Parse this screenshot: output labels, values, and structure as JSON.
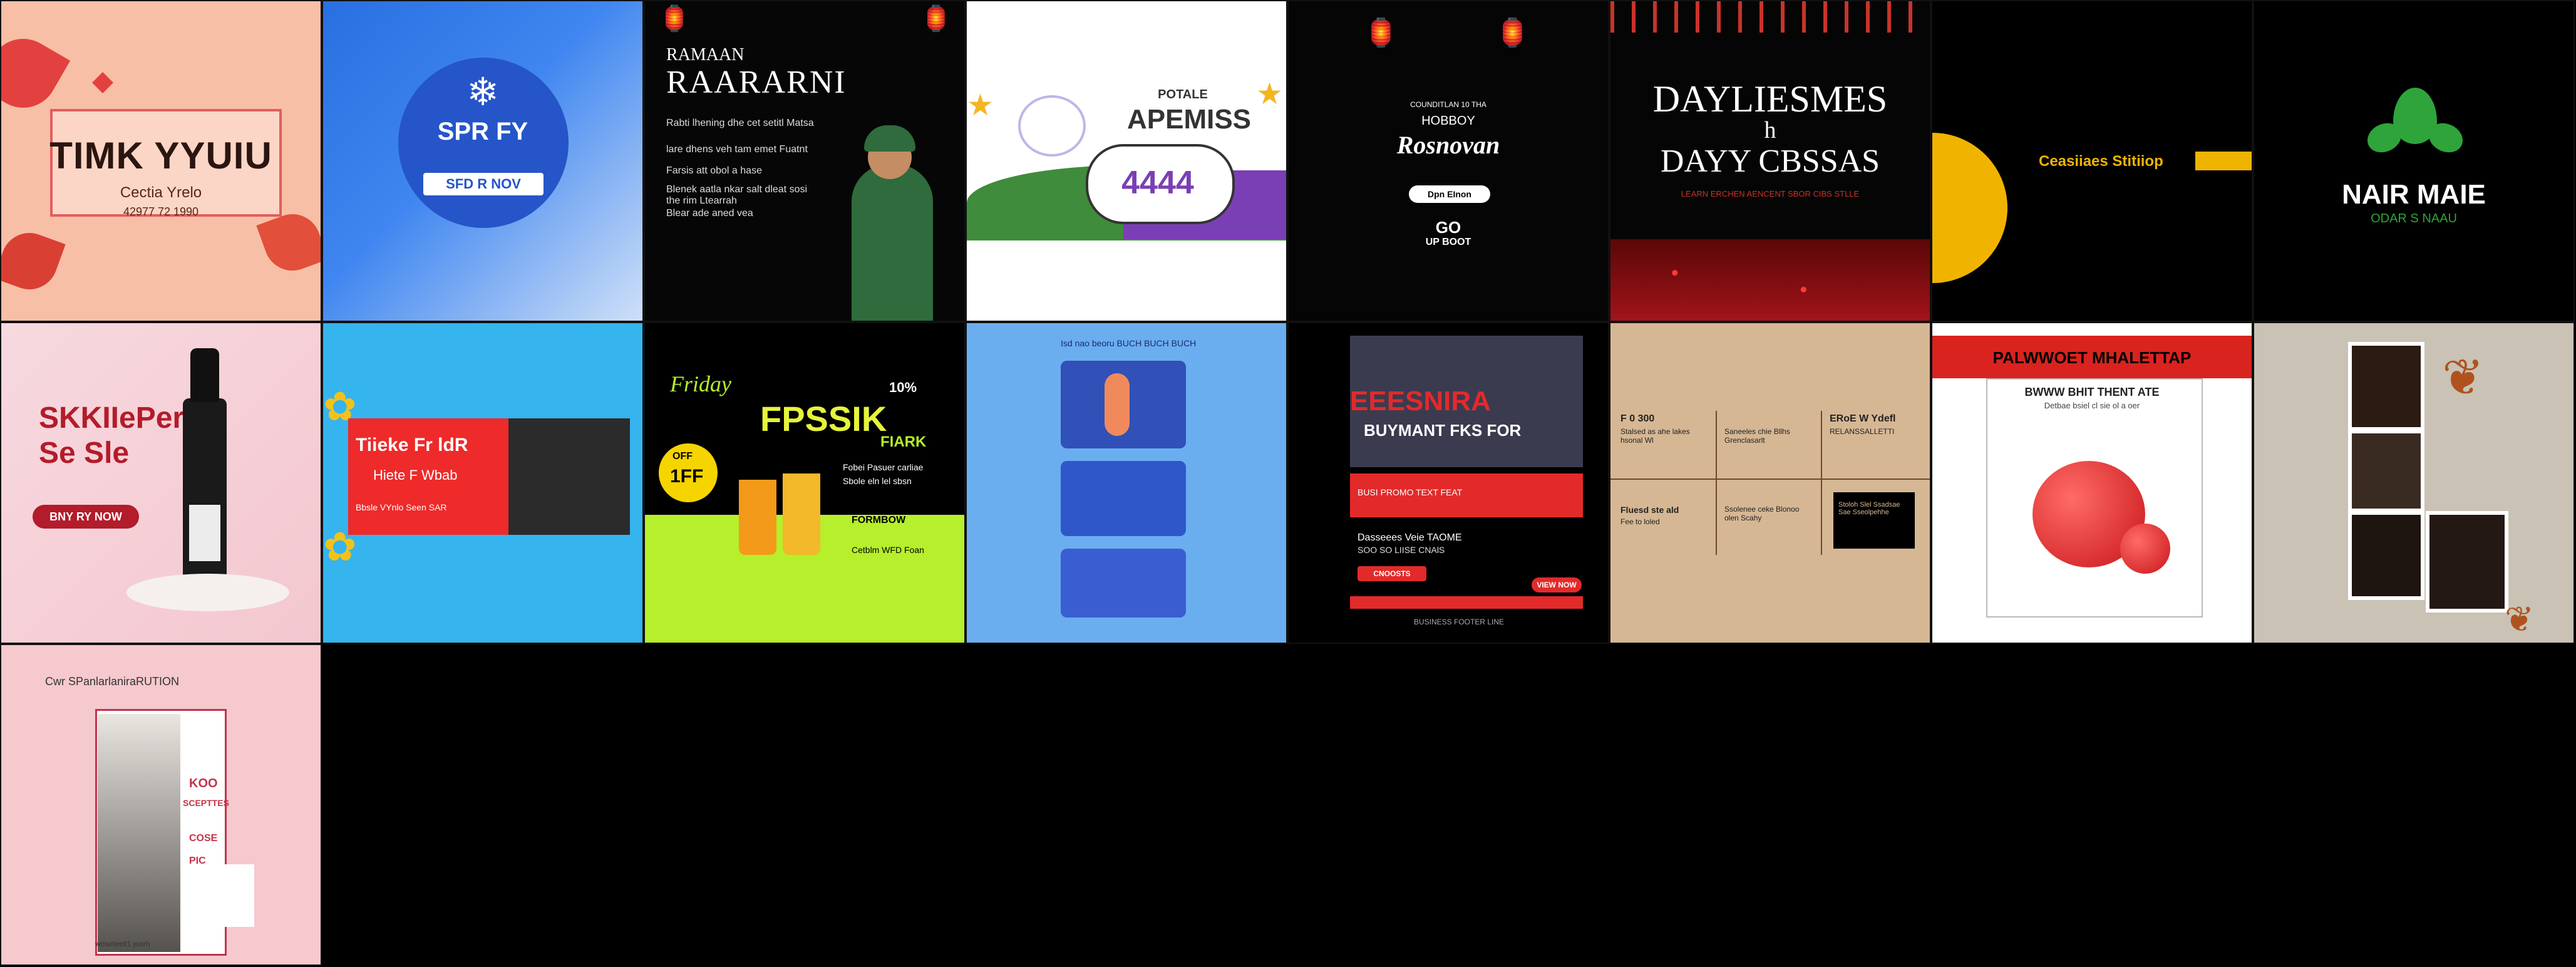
{
  "tiles": {
    "thank_you": {
      "title": "TIMK YYUIU",
      "subtitle": "Cectia Yrelo",
      "line": "42977 72 1990"
    },
    "spring": {
      "title": "SPR FY",
      "button": "SFD R NOV"
    },
    "ramadan": {
      "small": "RAMAAN",
      "title": "RAARARNI",
      "para1": "Rabti lhening dhe cet setitl Matsa",
      "para2": "lare dhens veh tam emet Fuatnt",
      "para3": "Farsis att obol a hase",
      "para4": "Blenek aatla nkar salt dleat sosi the rim Ltearrah",
      "para5": "Blear ade aned vea"
    },
    "unicorn": {
      "small": "POTALE",
      "title": "APEMISS",
      "numbers": "4444"
    },
    "hobby_ramadan": {
      "small": "COUNDITLAN 10 THA",
      "line1": "HOBBOY",
      "script": "Rosnovan",
      "button": "Dpn EInon",
      "num": "GO",
      "line3": "UP BOOT"
    },
    "daylights": {
      "line1": "DAYLIESMES",
      "line2": "h",
      "line3": "DAYY CBSSAS",
      "tagline": "LEARN ERCHEN AENCENT SBOR CIBS STLLE"
    },
    "studio": {
      "text": "Ceasiiaes Stitiiop"
    },
    "hair": {
      "title": "NAIR MAIE",
      "subtitle": "ODAR S NAAU"
    },
    "skincare": {
      "title1": "SKKIIePer",
      "title2": "Se Sle",
      "button": "BNY RY NOW"
    },
    "thanks_web": {
      "title": "Tiieke Fr ldR",
      "subtitle": "Hiete F Wbab",
      "line": "Bbsle VYnlo Seen SAR"
    },
    "juice": {
      "script": "Friday",
      "badge_top": "10%",
      "title": "FPSSIK",
      "sub": "FIARK",
      "pct": "OFF",
      "badge_num": "1FF",
      "text1": "Fobei Pasuer carliae",
      "text2": "Sbole eln lel sbsn",
      "text3": "FORMBOW",
      "text4": "Cetblm WFD Foan"
    },
    "illustration": {
      "header": "Isd nao beoru BUCH BUCH BUCH"
    },
    "business": {
      "title": "EEESNIRA",
      "subtitle": "BUYMANT FKS FOR",
      "line1": "BUSI PROMO TEXT FEAT",
      "line2": "Dasseees Veie TAOME",
      "line3": "SOO SO LIISE CNAlS",
      "button": "VIEW NOW",
      "btn2": "CNOOSTS",
      "foot": "BUSINESS FOOTER LINE"
    },
    "menu": {
      "cells": [
        {
          "title": "F 0 300",
          "body": "Stalsed as ahe lakes hsonal Wl"
        },
        {
          "title": "",
          "body": "Saneeles chie Bllhs Grenclasarlt"
        },
        {
          "title": "ERoE W Ydefl",
          "body": "RELANSSALLETTI"
        },
        {
          "title": "Fluesd ste ald",
          "body": "Fee to loled"
        },
        {
          "title": "",
          "body": "Ssolenee ceke Blonoo olen Scahy"
        },
        {
          "title": "",
          "body": "Stoloh Slel Ssadsae Sae Sseolpehhe"
        }
      ]
    },
    "product": {
      "banner": "PALWWOET MHALETTAP",
      "card_title": "BWWW BHIT THENT ATE",
      "card_body": "Detbae bsiel cl sie ol a oer"
    },
    "collage": {},
    "fashion": {
      "title": "Cwr SPanlarlaniraRUTION",
      "side1": "KOO",
      "side2": "SCEPTTES",
      "side3": "COSE",
      "side4": "PIC",
      "foot": "woseteelt1 jearh"
    }
  }
}
